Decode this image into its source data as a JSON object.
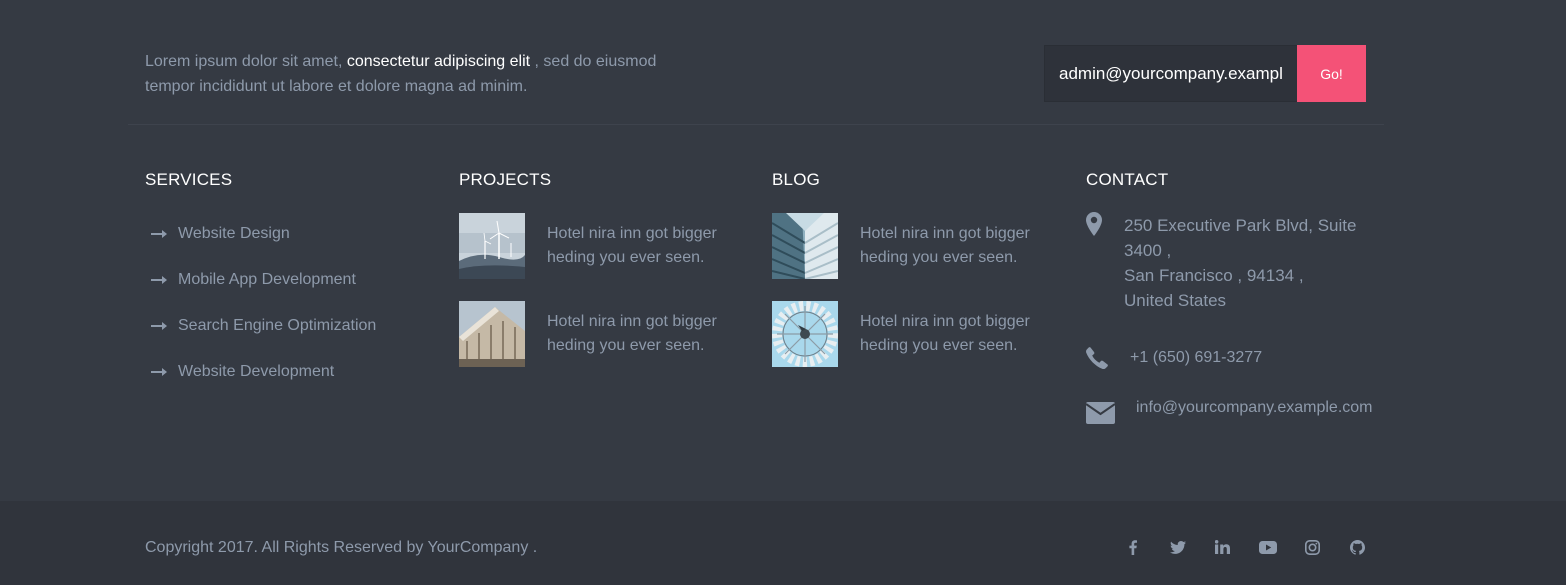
{
  "intro": {
    "text_before": "Lorem ipsum dolor sit amet, ",
    "highlight": "consectetur adipiscing elit",
    "text_after": " , sed do eiusmod tempor incididunt ut labore et dolore magna ad minim."
  },
  "subscribe": {
    "email_value": "admin@yourcompany.example.com",
    "button_label": "Go!"
  },
  "services": {
    "heading": "SERVICES",
    "items": [
      {
        "label": "Website Design"
      },
      {
        "label": "Mobile App Development"
      },
      {
        "label": "Search Engine Optimization"
      },
      {
        "label": "Website Development"
      }
    ]
  },
  "projects": {
    "heading": "PROJECTS",
    "items": [
      {
        "title": "Hotel nira inn got bigger heding you ever seen.",
        "image": "wind-turbines"
      },
      {
        "title": "Hotel nira inn got bigger heding you ever seen.",
        "image": "wooden-building"
      }
    ]
  },
  "blog": {
    "heading": "BLOG",
    "items": [
      {
        "title": "Hotel nira inn got bigger heding you ever seen.",
        "image": "skyscraper"
      },
      {
        "title": "Hotel nira inn got bigger heding you ever seen.",
        "image": "windmill"
      }
    ]
  },
  "contact": {
    "heading": "CONTACT",
    "address_line1": "250 Executive Park Blvd, Suite 3400 ,",
    "address_line2": "San Francisco , 94134 ,",
    "address_line3": "United States",
    "phone": "+1 (650) 691-3277",
    "email": "info@yourcompany.example.com",
    "icons": [
      "map-marker-icon",
      "phone-icon",
      "envelope-icon"
    ]
  },
  "footer": {
    "copyright": "Copyright 2017. All Rights Reserved by YourCompany .",
    "social": [
      "facebook-icon",
      "twitter-icon",
      "linkedin-icon",
      "youtube-icon",
      "instagram-icon",
      "github-icon"
    ]
  },
  "colors": {
    "background": "#353a43",
    "bottom_bar": "#30343c",
    "accent": "#f45277",
    "text_muted": "#8e9aab",
    "heading": "#ffffff"
  }
}
